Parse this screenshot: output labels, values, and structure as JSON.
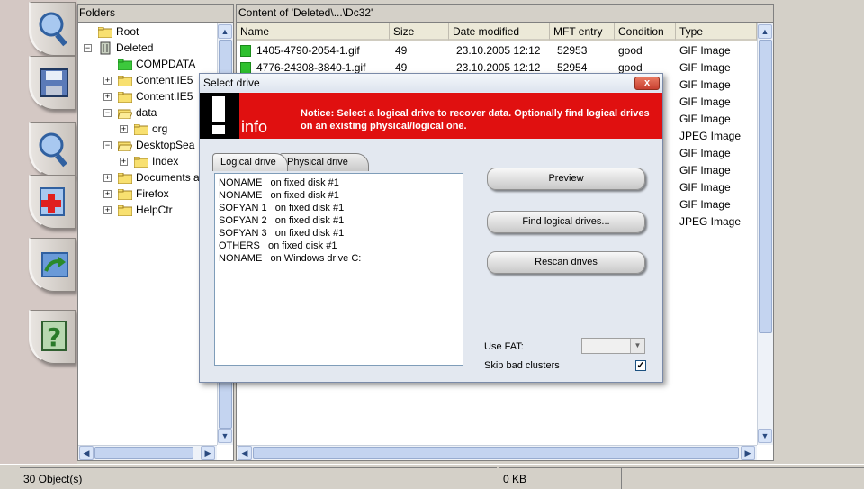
{
  "toolbar": {
    "buttons": [
      "search-icon",
      "save-icon",
      "search-icon",
      "add-icon",
      "refresh-icon",
      "help-icon"
    ]
  },
  "folders": {
    "header": "Folders",
    "items": [
      {
        "label": "Root",
        "level": 0
      },
      {
        "label": "Deleted",
        "level": 0
      },
      {
        "label": "COMPDATA",
        "level": 1
      },
      {
        "label": "Content.IE5",
        "level": 1
      },
      {
        "label": "Content.IE5",
        "level": 1
      },
      {
        "label": "data",
        "level": 1
      },
      {
        "label": "org",
        "level": 2
      },
      {
        "label": "DesktopSea",
        "level": 1
      },
      {
        "label": "Index",
        "level": 2
      },
      {
        "label": "Documents a",
        "level": 1
      },
      {
        "label": "Firefox",
        "level": 1
      },
      {
        "label": "HelpCtr",
        "level": 1
      }
    ]
  },
  "content": {
    "header": "Content of 'Deleted\\...\\Dc32'",
    "columns": [
      "Name",
      "Size",
      "Date modified",
      "MFT entry",
      "Condition",
      "Type"
    ],
    "rows": [
      {
        "name": "1405-4790-2054-1.gif",
        "size": "49",
        "date": "23.10.2005 12:12",
        "mft": "52953",
        "condition": "good",
        "type": "GIF Image"
      },
      {
        "name": "4776-24308-3840-1.gif",
        "size": "49",
        "date": "23.10.2005 12:12",
        "mft": "52954",
        "condition": "good",
        "type": "GIF Image"
      }
    ],
    "hidden_types": [
      "GIF Image",
      "GIF Image",
      "GIF Image",
      "JPEG Image",
      "GIF Image",
      "GIF Image",
      "GIF Image",
      "GIF Image",
      "JPEG Image"
    ]
  },
  "status": {
    "objects": "30 Object(s)",
    "size": "0 KB"
  },
  "dialog": {
    "title": "Select drive",
    "close_label": "x",
    "banner_word": "info",
    "notice": "Notice: Select a logical drive to recover data. Optionally find logical drives on an existing physical/logical one.",
    "tabs": [
      "Logical drive",
      "Physical drive"
    ],
    "drives": [
      "NONAME   on fixed disk #1",
      "NONAME   on fixed disk #1",
      "SOFYAN 1   on fixed disk #1",
      "SOFYAN 2   on fixed disk #1",
      "SOFYAN 3   on fixed disk #1",
      "OTHERS   on fixed disk #1",
      "NONAME   on Windows drive C:"
    ],
    "preview_button": "Preview",
    "find_button": "Find logical drives...",
    "rescan_button": "Rescan drives",
    "use_fat_label": "Use FAT:",
    "use_fat_value": "",
    "skip_label": "Skip bad clusters",
    "skip_checked": true
  }
}
